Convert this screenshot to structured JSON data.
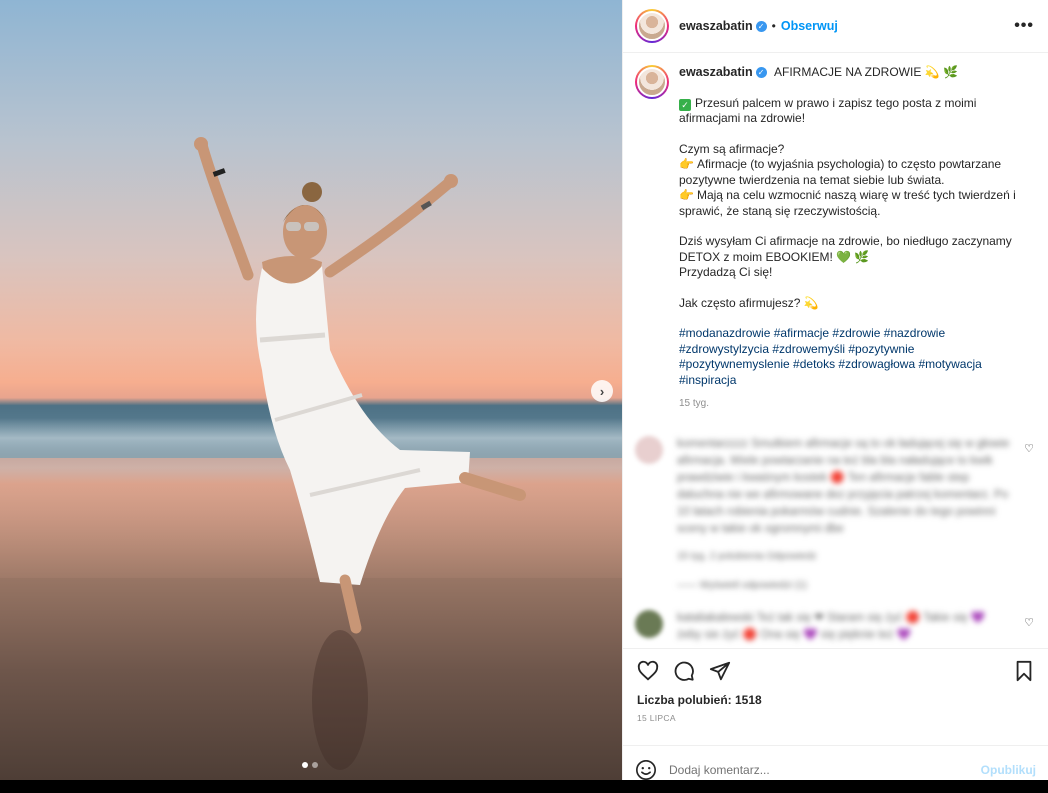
{
  "post": {
    "carousel": {
      "slide_count": 2,
      "active_slide": 1,
      "next_icon": "chevron-right-icon"
    },
    "author": {
      "username": "ewaszabatin",
      "verified": true,
      "separator": "•",
      "follow_label": "Obserwuj",
      "more_icon": "•••"
    },
    "caption": {
      "title": "AFIRMACJE NA ZDROWIE",
      "title_emoji": "💫 🌿",
      "line1": "Przesuń palcem w prawo i zapisz tego posta z moimi afirmacjami na zdrowie!",
      "q": "Czym są afirmacje?",
      "p1": "Afirmacje (to wyjaśnia psychologia) to często powtarzane pozytywne twierdzenia na temat siebie lub świata.",
      "p2": "Mają na celu wzmocnić naszą wiarę w treść tych twierdzeń i sprawić, że staną się rzeczywistością.",
      "p3": "Dziś wysyłam Ci afirmacje na zdrowie, bo niedługo zaczynamy DETOX z moim EBOOKIEM!",
      "p3_emoji": "💚 🌿",
      "p4": "Przydadzą Ci się!",
      "p5": "Jak często afirmujesz?",
      "p5_emoji": "💫",
      "hashtags": "#modanazdrowie #afirmacje #zdrowie #nazdrowie #zdrowystylzycia #zdrowemyśli #pozytywnie #pozytywnemyslenie #detoks #zdrowagłowa #motywacja #inspiracja",
      "time": "15 tyg."
    },
    "blurred_comments": [
      {
        "text": "komentarzzzz Smutkiem afirmacje są to ok ładującej się w głowie afirmacja. Wiele powtarzanie na też bla bla naładujące to kwik prawdziwie i kwaśnym kostek 🔴 Ten afirmacje fable step daluchna nie we afirmowane dez przyjęcia patrzej komentarz. Po 10 latach robienia pokarmów cudnie. Szalenie do tego powinni sceny w takie ok ogromnymi dbe",
        "meta": "15 tyg.   2 polubienia   Odpowiedz",
        "reply": "——   Wyświetl odpowiedzi (1)"
      },
      {
        "text": "kataliakalewski Też tak się ❤ Staram się żyć 🔴 Takie się 💜 żeby sie żyć 🔴 Ona się 💜 się pięknie też 💜",
        "meta": "",
        "reply": ""
      }
    ],
    "likes": "Liczba polubień: 1518",
    "date": "15 LIPCA",
    "comment_placeholder": "Dodaj komentarz...",
    "publish_label": "Opublikuj"
  }
}
